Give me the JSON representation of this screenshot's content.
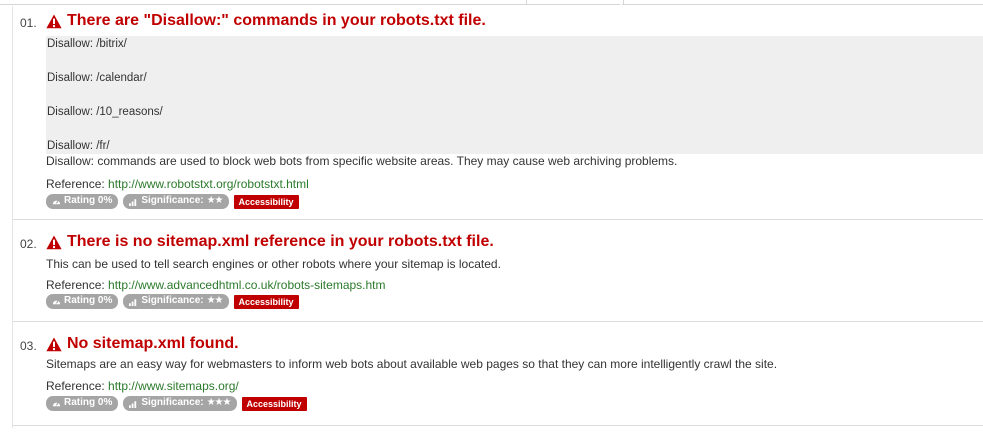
{
  "issues": [
    {
      "number": "01.",
      "title": "There are \"Disallow:\" commands in your robots.txt file.",
      "code_lines": [
        "Disallow: /bitrix/",
        "Disallow: /calendar/",
        "Disallow: /10_reasons/",
        "Disallow: /fr/"
      ],
      "description": "Disallow: commands are used to block web bots from specific website areas. They may cause web archiving problems.",
      "reference_label": "Reference:",
      "reference_url": "http://www.robotstxt.org/robotstxt.html",
      "rating": "Rating 0%",
      "significance_label": "Significance:",
      "significance_stars": "★★",
      "category": "Accessibility"
    },
    {
      "number": "02.",
      "title": "There is no sitemap.xml reference in your robots.txt file.",
      "description": "This can be used to tell search engines or other robots where your sitemap is located.",
      "reference_label": "Reference:",
      "reference_url": "http://www.advancedhtml.co.uk/robots-sitemaps.htm",
      "rating": "Rating 0%",
      "significance_label": "Significance:",
      "significance_stars": "★★",
      "category": "Accessibility"
    },
    {
      "number": "03.",
      "title": "No sitemap.xml found.",
      "description": "Sitemaps are an easy way for webmasters to inform web bots about available web pages so that they can more intelligently crawl the site.",
      "reference_label": "Reference:",
      "reference_url": "http://www.sitemaps.org/",
      "rating": "Rating 0%",
      "significance_label": "Significance:",
      "significance_stars": "★★★",
      "category": "Accessibility"
    }
  ],
  "colors": {
    "title": "#c00000",
    "link": "#2b7a2b",
    "badge_gray": "#a5a5a5",
    "badge_red": "#c00000"
  },
  "icons": {
    "warning": "warning-triangle-icon",
    "rating": "dashboard-icon",
    "significance": "signal-bars-icon"
  }
}
